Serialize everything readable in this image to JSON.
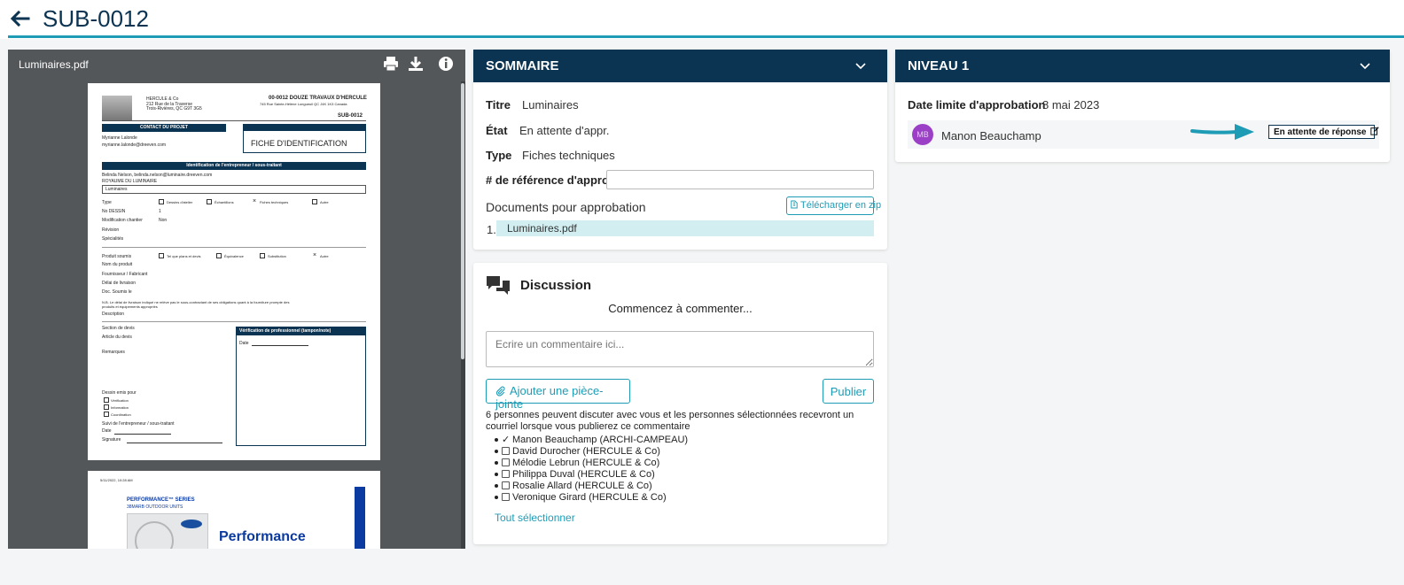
{
  "header": {
    "title": "SUB-0012"
  },
  "viewer": {
    "file_name": "Luminaires.pdf",
    "page1": {
      "company": "HERCULE & Co",
      "company_addr1": "212 Rue de la Traverse",
      "company_addr2": "Trois-Rivières, QC G9T 3G5",
      "project": "00-0012 DOUZE TRAVAUX D'HERCULE",
      "project_addr": "745 Rue Sainte-Hélène Longueuil QC J4K 1K3 Canada",
      "sub_no": "SUB-0012",
      "contact_bar": "CONTACT DU PROJET",
      "contact_name": "Myrianne Lalonde",
      "contact_email": "myrianne.lalonde@dreeven.com",
      "fiche_title": "FICHE D'IDENTIFICATION",
      "ident_bar": "Identification de l'entrepreneur / sous-traitant",
      "sub_contact": "Belinda Nelson, belinda.nelson@luminaire.dreeven.com",
      "sub_company": "ROYAUME DU LUMINAIRE",
      "sub_title": "Luminaires",
      "type_label": "Type",
      "type_opts": [
        "Dessins d'atelier",
        "Échantillons",
        "Fiches techniques",
        "Autre"
      ],
      "no_dessin_label": "No DESSIN",
      "no_dessin_val": "1",
      "modif_label": "Modification chantier",
      "modif_val": "Non",
      "revision_label": "Révision",
      "specialites_label": "Spécialités",
      "produit_label": "Produit soumis",
      "produit_opts": [
        "Tel que plans et devis",
        "Équivalence",
        "Substitution",
        "Autre"
      ],
      "nom_produit": "Nom du produit",
      "fournisseur": "Fournisseur / Fabricant",
      "delai": "Délai de livraison",
      "doc_soumis": "Doc. Soumis le",
      "nb_text1": "N.B. Le délai de livraison indiqué ne relève pas le sous-contractant de ses obligations quant à la fourniture prompte des",
      "nb_text2": "produits et équipements appropriés",
      "description": "Description",
      "section_devis": "Section de devis",
      "article_devis": "Article du devis",
      "remarques": "Remarques",
      "verif_bar": "Vérification de professionnel (tampon/note)",
      "verif_date": "Date",
      "dessin_emis": "Dessin emis pour",
      "dessin_opts": [
        "Vérification",
        "Information",
        "Coordination"
      ],
      "suivi": "Suivi de l'entrepreneur / sous-traitant",
      "date_label": "Date",
      "signature_label": "Signature"
    },
    "page2": {
      "timestamp": "5/11/2022, 10:28 AM",
      "series": "PERFORMANCE™ SERIES",
      "units": "38MARB OUTDOOR UNITS",
      "brand": "Performance"
    }
  },
  "summary": {
    "heading": "SOMMAIRE",
    "titre_label": "Titre",
    "titre_value": "Luminaires",
    "etat_label": "État",
    "etat_value": "En attente d'appr.",
    "type_label": "Type",
    "type_value": "Fiches techniques",
    "ref_label": "# de référence d'approb.",
    "ref_value": "",
    "docs_label": "Documents pour approbation",
    "zip_label": "Télécharger en zip",
    "docs": [
      {
        "num": "1.",
        "name": "Luminaires.pdf"
      }
    ]
  },
  "discussion": {
    "heading": "Discussion",
    "prompt": "Commencez à commenter...",
    "comment_placeholder": "Ecrire un commentaire ici...",
    "attach_label": "Ajouter une pièce-jointe",
    "publish_label": "Publier",
    "info_text": "6 personnes peuvent discuter avec vous et les personnes sélectionnées recevront un courriel lorsque vous publierez ce commentaire",
    "participants": [
      {
        "name": "Manon Beauchamp (ARCHI-CAMPEAU)",
        "checked": true
      },
      {
        "name": "David Durocher (HERCULE & Co)",
        "checked": false
      },
      {
        "name": "Mélodie Lebrun (HERCULE & Co)",
        "checked": false
      },
      {
        "name": "Philippa Duval (HERCULE & Co)",
        "checked": false
      },
      {
        "name": "Rosalie Allard (HERCULE & Co)",
        "checked": false
      },
      {
        "name": "Veronique Girard (HERCULE & Co)",
        "checked": false
      }
    ],
    "select_all": "Tout sélectionner"
  },
  "level": {
    "heading": "NIVEAU 1",
    "deadline_label": "Date limite d'approbation",
    "deadline_value": "8 mai 2023",
    "approver_initials": "MB",
    "approver_name": "Manon Beauchamp",
    "status_label": "En attente de réponse"
  },
  "colors": {
    "navy": "#0b3352",
    "teal": "#1f9cb5",
    "avatar": "#9b40c6",
    "doc_highlight": "#d3eef1",
    "viewer_bg": "#54575a"
  },
  "icons": [
    "back-arrow-icon",
    "print-icon",
    "download-icon",
    "info-icon",
    "chevron-down-icon",
    "zip-file-icon",
    "chat-icon",
    "paperclip-icon",
    "edit-icon",
    "arrow-pointer-icon"
  ]
}
